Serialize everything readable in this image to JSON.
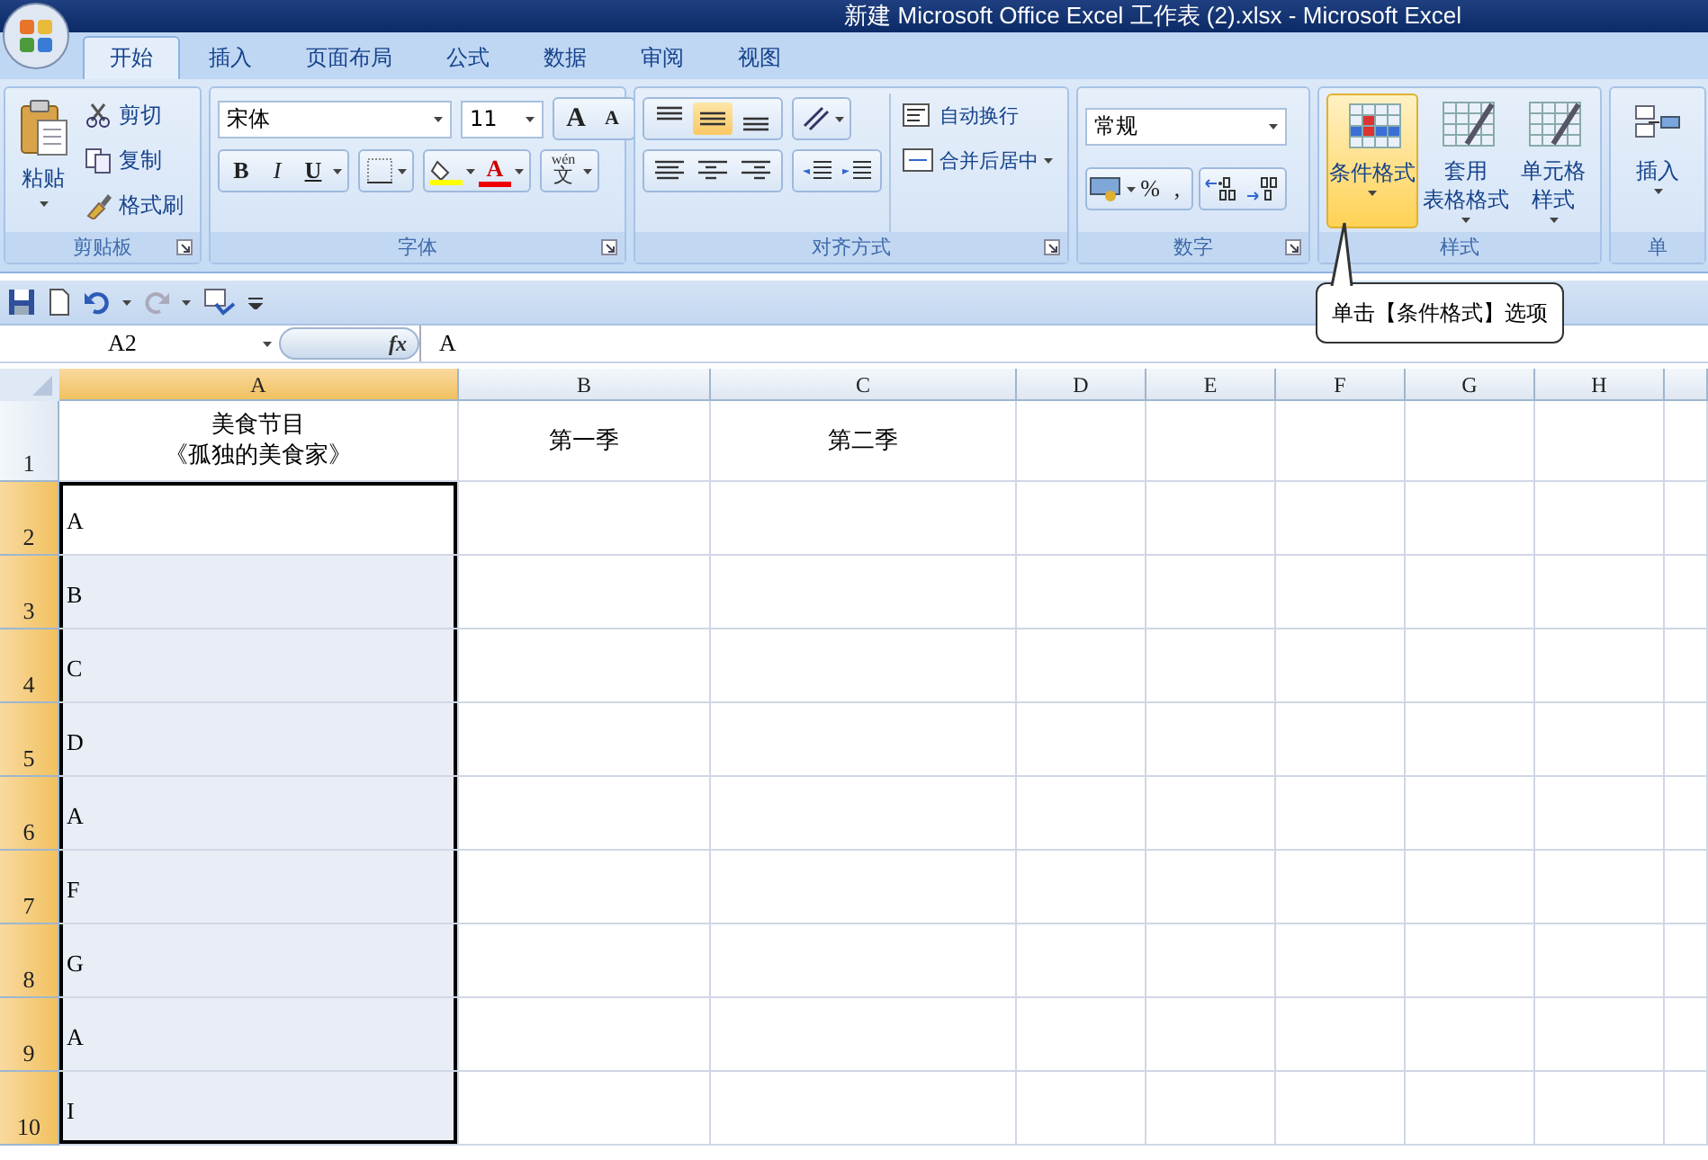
{
  "window": {
    "title": "新建 Microsoft Office Excel 工作表 (2).xlsx - Microsoft Excel"
  },
  "tabs": [
    {
      "label": "开始",
      "selected": true
    },
    {
      "label": "插入",
      "selected": false
    },
    {
      "label": "页面布局",
      "selected": false
    },
    {
      "label": "公式",
      "selected": false
    },
    {
      "label": "数据",
      "selected": false
    },
    {
      "label": "审阅",
      "selected": false
    },
    {
      "label": "视图",
      "selected": false
    }
  ],
  "ribbon": [
    {
      "kind": "clipboard",
      "label": "剪贴板",
      "paste": "粘贴",
      "items": [
        "剪切",
        "复制",
        "格式刷"
      ]
    },
    {
      "kind": "font",
      "label": "字体",
      "font": "宋体",
      "size": "11",
      "size_buttons": [
        "A",
        "A"
      ],
      "format_buttons": [
        "B",
        "I",
        "U"
      ],
      "font_color": "A",
      "phonetic": {
        "top": "wén",
        "main": "文"
      }
    },
    {
      "kind": "alignment",
      "label": "对齐方式",
      "vertical": [
        {
          "selected": false
        },
        {
          "selected": true
        },
        {
          "selected": false
        }
      ],
      "wrap": "自动换行",
      "merge": "合并后居中"
    },
    {
      "kind": "number",
      "label": "数字",
      "format": "常规",
      "buttons": [
        "%",
        ","
      ]
    },
    {
      "kind": "styles",
      "label": "样式",
      "buttons": [
        {
          "lines": [
            "条件格式"
          ],
          "selected": true
        },
        {
          "lines": [
            "套用",
            "表格格式"
          ],
          "selected": false
        },
        {
          "lines": [
            "单元格",
            "样式"
          ],
          "selected": false
        }
      ]
    },
    {
      "kind": "cells",
      "label": "单",
      "buttons": [
        {
          "lines": [
            "插入"
          ],
          "selected": false
        }
      ]
    }
  ],
  "formula_bar": {
    "name_box": "A2",
    "fx": "fx",
    "value": "A"
  },
  "callout": {
    "text": "单击【条件格式】选项"
  },
  "sheet": {
    "columns": [
      {
        "label": "A",
        "selected": true
      },
      {
        "label": "B",
        "selected": false
      },
      {
        "label": "C",
        "selected": false
      },
      {
        "label": "D",
        "selected": false
      },
      {
        "label": "E",
        "selected": false
      },
      {
        "label": "F",
        "selected": false
      },
      {
        "label": "G",
        "selected": false
      },
      {
        "label": "H",
        "selected": false
      }
    ],
    "rows": [
      {
        "number": "1",
        "selected": false,
        "cells": [
          [
            "美食节目",
            "《孤独的美食家》"
          ],
          "第一季",
          "第二季"
        ]
      },
      {
        "number": "2",
        "selected": true,
        "cells": [
          "A"
        ]
      },
      {
        "number": "3",
        "selected": true,
        "cells": [
          "B"
        ]
      },
      {
        "number": "4",
        "selected": true,
        "cells": [
          "C"
        ]
      },
      {
        "number": "5",
        "selected": true,
        "cells": [
          "D"
        ]
      },
      {
        "number": "6",
        "selected": true,
        "cells": [
          "A"
        ]
      },
      {
        "number": "7",
        "selected": true,
        "cells": [
          "F"
        ]
      },
      {
        "number": "8",
        "selected": true,
        "cells": [
          "G"
        ]
      },
      {
        "number": "9",
        "selected": true,
        "cells": [
          "A"
        ]
      },
      {
        "number": "10",
        "selected": true,
        "cells": [
          "I"
        ]
      }
    ]
  }
}
